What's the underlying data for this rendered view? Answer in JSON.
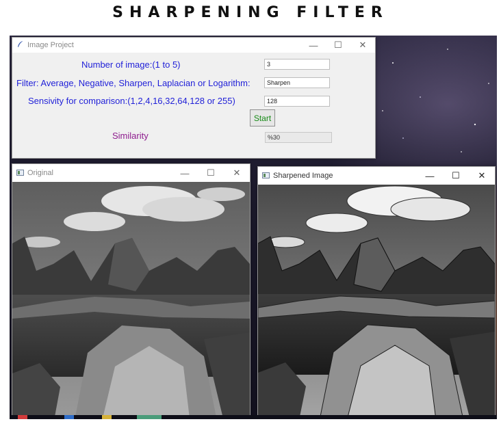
{
  "page_title": "SHARPENING FILTER",
  "panel": {
    "title": "Image Project",
    "number_label": "Number of image:(1 to 5)",
    "number_value": "3",
    "filter_label": "Filter: Average, Negative, Sharpen, Laplacian or Logarithm:",
    "filter_value": "Sharpen",
    "sensivity_label": "Sensivity for comparison:(1,2,4,16,32,64,128 or 255)",
    "sensivity_value": "128",
    "start_label": "Start",
    "similarity_label": "Similarity",
    "similarity_value": "%30"
  },
  "original_window": {
    "title": "Original"
  },
  "sharpened_window": {
    "title": "Sharpened Image"
  },
  "window_controls": {
    "minimize": "—",
    "maximize": "☐",
    "close": "✕"
  },
  "colors": {
    "label_blue": "#1f1fd8",
    "similarity_purple": "#8e1c8e",
    "start_green": "#158a15"
  }
}
